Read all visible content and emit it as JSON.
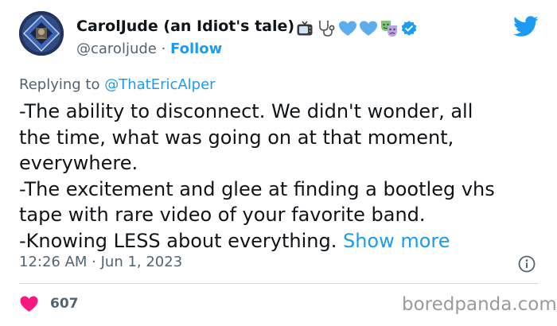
{
  "author": {
    "display_name": "CarolJude (an Idiot's tale)",
    "handle": "@caroljude",
    "separator": " · ",
    "follow_label": "Follow",
    "badges": [
      "tv-icon",
      "stethoscope-icon",
      "blue-heart-icon",
      "blue-heart-icon",
      "performing-arts-icon",
      "verified-badge-icon"
    ]
  },
  "reply": {
    "prefix": "Replying to ",
    "mention": "@ThatEricAlper"
  },
  "tweet": {
    "lines": [
      "-The ability to disconnect. We didn't wonder, all",
      "the time, what was going on at that moment,",
      "everywhere.",
      "-The excitement and glee at finding a bootleg vhs",
      "tape with rare video of your favorite band."
    ],
    "last_line": "-Knowing LESS about everything. ",
    "show_more": "Show more"
  },
  "meta": {
    "time": "12:26 AM · Jun 1, 2023"
  },
  "stats": {
    "likes": "607"
  },
  "watermark": "boredpanda.com",
  "colors": {
    "accent": "#1d9bf0",
    "secondary_text": "#536471",
    "like": "#f91880",
    "text": "#0f1419"
  }
}
